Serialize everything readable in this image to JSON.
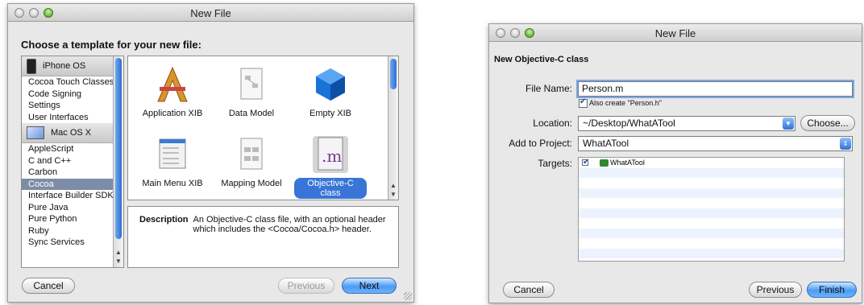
{
  "window1": {
    "title": "New File",
    "heading": "Choose a template for your new file:",
    "categories": {
      "iphone_section": "iPhone OS",
      "iphone_items": [
        "Cocoa Touch Classes",
        "Code Signing",
        "Settings",
        "User Interfaces"
      ],
      "mac_section": "Mac OS X",
      "mac_items": [
        "AppleScript",
        "C and C++",
        "Carbon",
        "Cocoa",
        "Interface Builder SDK",
        "Pure Java",
        "Pure Python",
        "Ruby",
        "Sync Services"
      ],
      "selected": "Cocoa"
    },
    "templates": [
      "Application XIB",
      "Data Model",
      "Empty XIB",
      "Main Menu XIB",
      "Mapping Model",
      "Objective-C class"
    ],
    "selected_template": "Objective-C class",
    "description_label": "Description",
    "description_line1": "An Objective-C class file, with an optional header",
    "description_line2": "which includes the <Cocoa/Cocoa.h> header.",
    "buttons": {
      "cancel": "Cancel",
      "previous": "Previous",
      "next": "Next"
    }
  },
  "window2": {
    "title": "New File",
    "heading": "New Objective-C class",
    "file_name_label": "File Name:",
    "file_name_value": "Person.m",
    "also_create_label": "Also create \"Person.h\"",
    "location_label": "Location:",
    "location_value": "~/Desktop/WhatATool",
    "choose_button": "Choose...",
    "add_to_project_label": "Add to Project:",
    "add_to_project_value": "WhatATool",
    "targets_label": "Targets:",
    "target_name": "WhatATool",
    "buttons": {
      "cancel": "Cancel",
      "previous": "Previous",
      "finish": "Finish"
    }
  },
  "colors": {
    "selection": "#7d8da7",
    "accent_blue": "#3875d7",
    "default_button": "#4a9bf5"
  }
}
